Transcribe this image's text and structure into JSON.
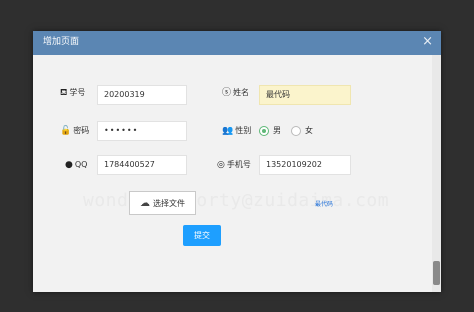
{
  "dialog": {
    "title": "增加页面",
    "close_glyph": "×"
  },
  "form": {
    "student_id": {
      "icon": "⛾",
      "label": "学号",
      "value": "20200319"
    },
    "name": {
      "icon": "ⓢ",
      "label": "姓名",
      "value": "最代码"
    },
    "password": {
      "icon": "🔓",
      "label": "密码",
      "value": "••••••"
    },
    "gender": {
      "icon": "👥",
      "label": "性别",
      "options": [
        "男",
        "女"
      ],
      "selected": "男"
    },
    "qq": {
      "icon": "●",
      "label": "QQ",
      "value": "1784400527"
    },
    "phone": {
      "icon": "◎",
      "label": "手机号",
      "value": "13520109202"
    },
    "upload": {
      "icon": "☁",
      "label": "选择文件",
      "result": "最代码"
    },
    "submit_label": "提交"
  },
  "watermark": "wonderfulMorty@zuidaima.com",
  "colors": {
    "header": "#5b86b3",
    "submit": "#1e9fff",
    "radio_checked": "#5fb878",
    "name_field_bg": "#fbf4cc"
  }
}
